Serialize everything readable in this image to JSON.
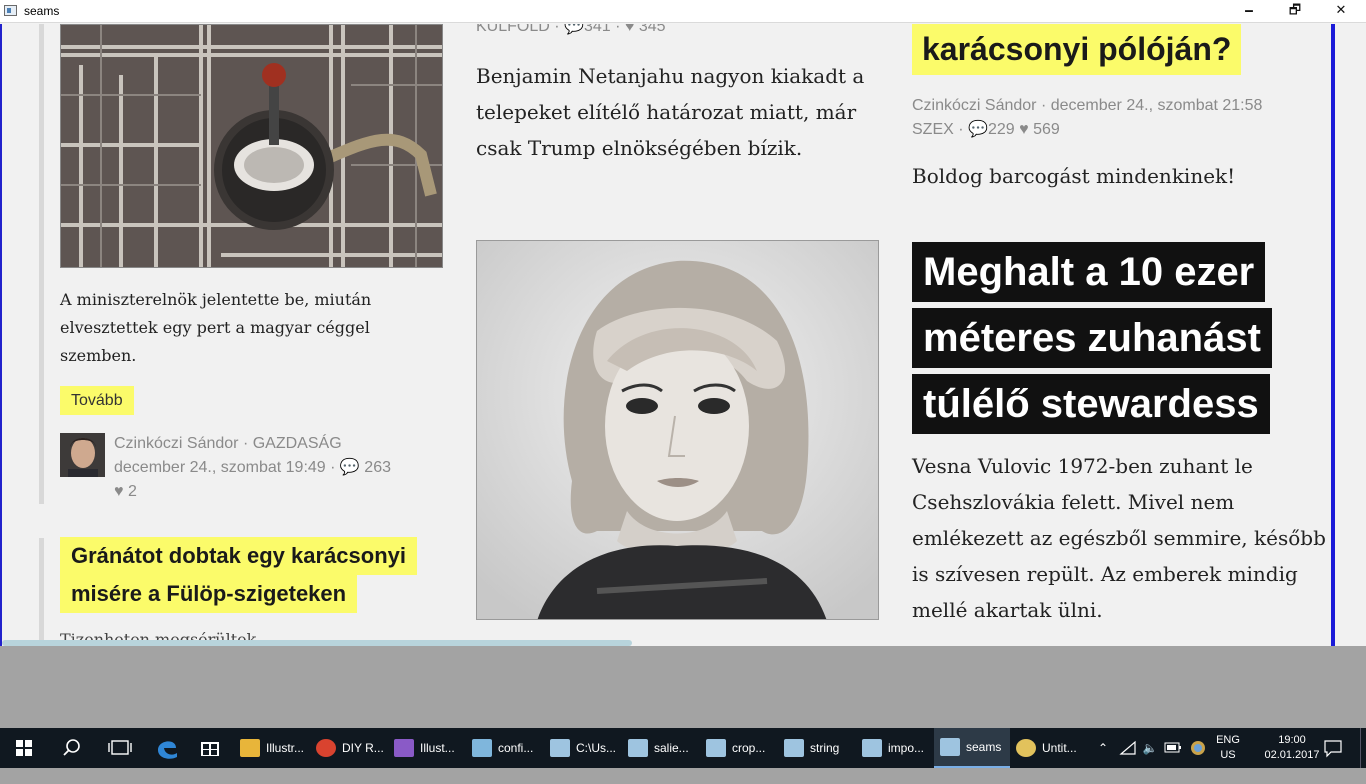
{
  "window": {
    "title": "seams",
    "minimize": "🗕",
    "maximize": "🗗",
    "close": "✕"
  },
  "left_column": {
    "excerpt": "A miniszterelnök jelentette be, miután elvesztettek egy pert a magyar céggel szemben.",
    "more_button": "Tovább",
    "author": "Czinkóczi Sándor",
    "category": "GAZDASÁG",
    "date": "december 24., szombat 19:49",
    "comments": "263",
    "likes": "2",
    "next_headline_line1": "Gránátot dobtak egy karácsonyi",
    "next_headline_line2": "misére a Fülöp-szigeteken",
    "next_excerpt_cut": "Tizenheten megsérültek"
  },
  "middle_column": {
    "category": "KÜLFÖLD",
    "comments": "341",
    "likes": "345",
    "excerpt": "Benjamin Netanjahu nagyon kiakadt a telepeket elítélő határozat miatt, már csak Trump elnökségében bízik."
  },
  "right_column": {
    "top_headline": "karácsonyi pólóján?",
    "author": "Czinkóczi Sándor",
    "date": "december 24., szombat 21:58",
    "category": "SZEX",
    "comments": "229",
    "likes": "569",
    "excerpt": "Boldog barcogást mindenkinek!",
    "headline_lines": [
      "Meghalt a 10 ezer",
      "méteres zuhanást",
      "túlélő stewardess"
    ],
    "article_excerpt": "Vesna Vulovic 1972-ben zuhant le Csehszlovákia felett. Mivel nem emlékezett az egészből semmire, később is szívesen repült. Az emberek mindig mellé akartak ülni."
  },
  "colors": {
    "highlight_yellow": "#fbfb6a",
    "black_headline": "#111111",
    "meta_gray": "#8a8a8a",
    "window_border_blue": "#1b1bd8"
  },
  "taskbar": {
    "apps": [
      {
        "label": "Illustr...",
        "icon": "folder-icon",
        "color": "#e8b53a"
      },
      {
        "label": "DIY R...",
        "icon": "chrome-icon",
        "color": "#d9432f"
      },
      {
        "label": "Illust...",
        "icon": "visual-studio-icon",
        "color": "#8a5ac7"
      },
      {
        "label": "confi...",
        "icon": "notepad-icon",
        "color": "#7fb6dc"
      },
      {
        "label": "C:\\Us...",
        "icon": "console-window-icon",
        "color": "#9ec4e0"
      },
      {
        "label": "salie...",
        "icon": "console-window-icon",
        "color": "#9ec4e0"
      },
      {
        "label": "crop...",
        "icon": "console-window-icon",
        "color": "#9ec4e0"
      },
      {
        "label": "string",
        "icon": "console-window-icon",
        "color": "#9ec4e0"
      },
      {
        "label": "impo...",
        "icon": "console-window-icon",
        "color": "#9ec4e0"
      },
      {
        "label": "seams",
        "icon": "console-window-icon",
        "color": "#9ec4e0"
      },
      {
        "label": "Untit...",
        "icon": "paint-icon",
        "color": "#e2c25c"
      }
    ],
    "lang_line1": "ENG",
    "lang_line2": "US",
    "time": "19:00",
    "date": "02.01.2017"
  }
}
